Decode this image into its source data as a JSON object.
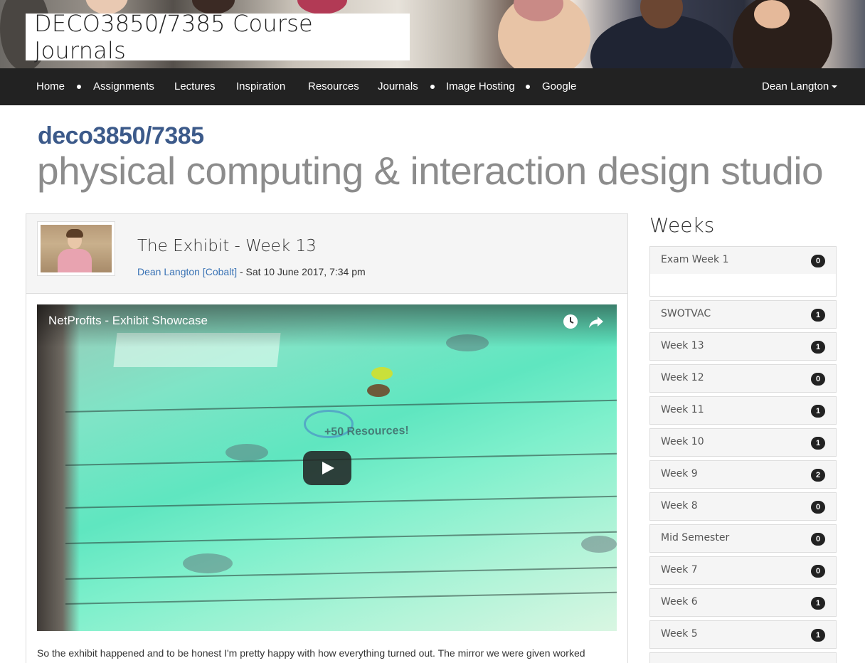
{
  "site": {
    "title": "DECO3850/7385 Course Journals"
  },
  "nav": {
    "items": [
      "Home",
      "Assignments",
      "Lectures",
      "Inspiration",
      "Resources",
      "Journals",
      "Image Hosting",
      "Google"
    ],
    "user": "Dean Langton"
  },
  "logo": {
    "top": "deco3850/7385",
    "bottom": "physical computing & interaction design studio"
  },
  "post": {
    "title": "The Exhibit - Week 13",
    "author": "Dean Langton [Cobalt]",
    "date": " - Sat 10 June 2017, 7:34 pm",
    "video": {
      "title": "NetProfits - Exhibit Showcase",
      "overlay_text": "+50 Resources!"
    },
    "body": "So the exhibit happened and to be honest I'm pretty happy with how everything turned out. The mirror we were given worked"
  },
  "sidebar": {
    "title": "Weeks",
    "weeks": [
      {
        "label": "Exam Week 1",
        "count": "0"
      },
      {
        "label": "SWOTVAC",
        "count": "1"
      },
      {
        "label": "Week 13",
        "count": "1"
      },
      {
        "label": "Week 12",
        "count": "0"
      },
      {
        "label": "Week 11",
        "count": "1"
      },
      {
        "label": "Week 10",
        "count": "1"
      },
      {
        "label": "Week 9",
        "count": "2"
      },
      {
        "label": "Week 8",
        "count": "0"
      },
      {
        "label": "Mid Semester",
        "count": "0"
      },
      {
        "label": "Week 7",
        "count": "0"
      },
      {
        "label": "Week 6",
        "count": "1"
      },
      {
        "label": "Week 5",
        "count": "1"
      }
    ]
  },
  "colors": {
    "navbar": "#222222",
    "link": "#3a73b5",
    "logo_blue": "#3c5a8a",
    "logo_gray": "#8c8c8c"
  }
}
